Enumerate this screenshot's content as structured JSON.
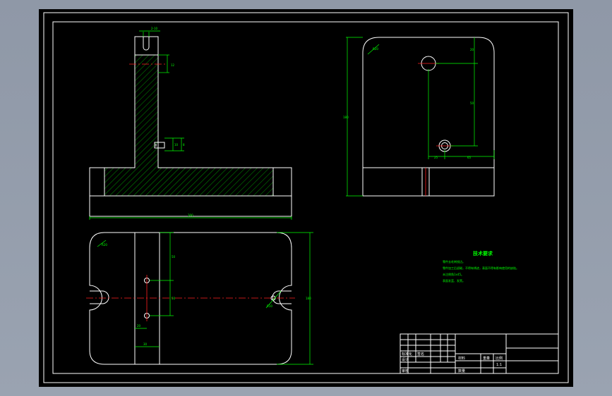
{
  "colors": {
    "background": "#9aa3b1",
    "canvas": "#000000",
    "outline": "#ffffff",
    "dimension": "#00ff00",
    "centerline": "#ff2020",
    "hatch": "#00ff00"
  },
  "front_view": {
    "dim_top": "2-10",
    "dim_right_upper": "12",
    "dim_right_lower": "8",
    "dim_mid": "10",
    "dim_bottom": "300"
  },
  "side_view": {
    "dim_left": "180",
    "dim_radius": "R20",
    "dim_top": "20",
    "dim_mid": "50",
    "dim_bottom_left": "25",
    "dim_bottom_right": "65"
  },
  "top_view": {
    "dim_radius": "R20",
    "dim_v1": "50",
    "dim_v2": "50",
    "dim_left_small": "20",
    "dim_bottom": "30",
    "dim_right": "180",
    "dim_slot": "R10"
  },
  "technical_requirements": {
    "title": "技术要求",
    "lines": [
      "零件去毛刺锐边。",
      "零件加工后退磁，不得有锈迹，表面不得有影响使用的缺陷。",
      "未注倒角1x45。",
      "表面发蓝、发黑。"
    ]
  },
  "title_block": {
    "label_scale": "比例",
    "label_qty": "数量",
    "label_weight": "重量",
    "label_material": "材料",
    "label_design": "设计",
    "label_check": "审核",
    "label_std": "标准化",
    "label_sign": "签名",
    "scale_value": "1:1"
  }
}
